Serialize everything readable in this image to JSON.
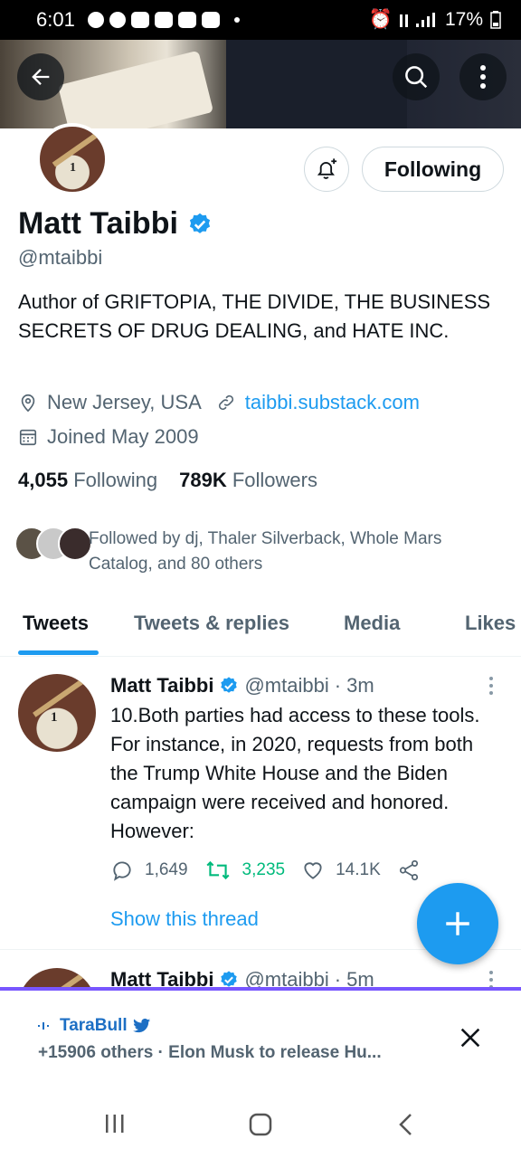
{
  "status": {
    "time": "6:01",
    "battery": "17%"
  },
  "profile": {
    "name": "Matt Taibbi",
    "handle": "@mtaibbi",
    "follow_label": "Following",
    "bio": "Author of GRIFTOPIA, THE DIVIDE, THE BUSINESS SECRETS OF DRUG DEALING, and HATE INC.",
    "location": "New Jersey, USA",
    "website": "taibbi.substack.com",
    "joined": "Joined May 2009",
    "following_count": "4,055",
    "following_label": "Following",
    "followers_count": "789K",
    "followers_label": "Followers",
    "followed_by": "Followed by dj, Thaler Silverback, Whole Mars Catalog, and 80 others"
  },
  "tabs": [
    "Tweets",
    "Tweets & replies",
    "Media",
    "Likes"
  ],
  "tweets": [
    {
      "name": "Matt Taibbi",
      "handle": "@mtaibbi",
      "time": "· 3m",
      "text": "10.Both parties had access to these tools. For instance, in 2020, requests from both the Trump White House and the Biden campaign were received and honored. However:",
      "replies": "1,649",
      "retweets": "3,235",
      "likes": "14.1K",
      "show_thread": "Show this thread"
    },
    {
      "name": "Matt Taibbi",
      "handle": "@mtaibbi",
      "time": "· 5m"
    }
  ],
  "notification": {
    "user": "TaraBull",
    "text": "+15906 others · Elon Musk to release Hu..."
  },
  "colors": {
    "accent": "#1d9bf0",
    "retweet": "#00ba7c",
    "secondary_text": "#536471"
  }
}
